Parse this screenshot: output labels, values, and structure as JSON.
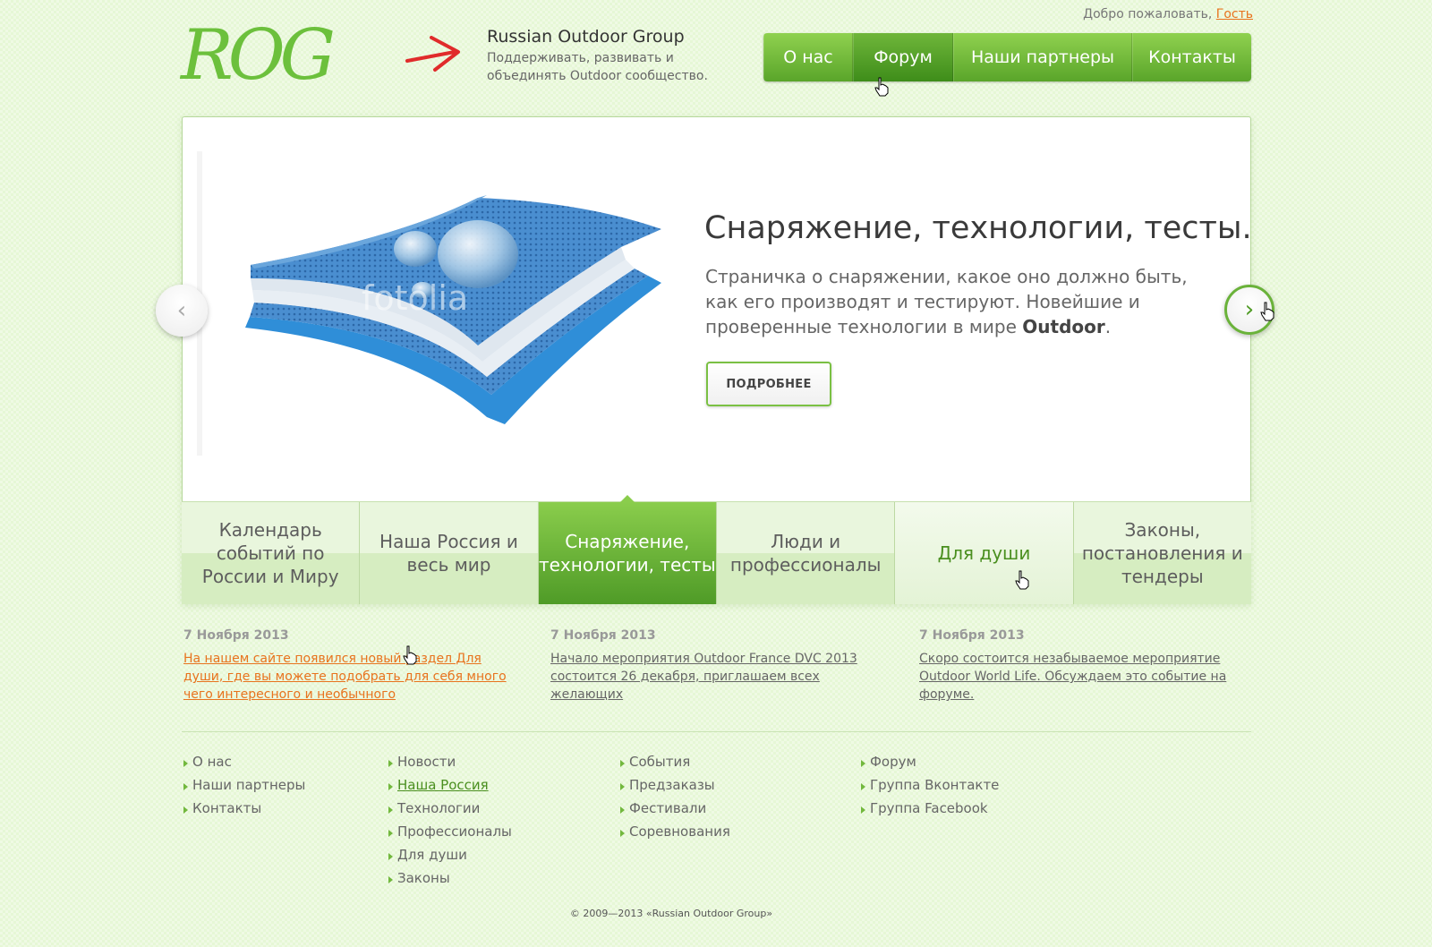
{
  "header": {
    "welcome_text": "Добро пожаловать,",
    "welcome_user": "Гость",
    "brand_title": "Russian Outdoor Group",
    "brand_tagline": "Поддерживать, развивать и объединять Outdoor сообщество.",
    "logo_text": "ROG"
  },
  "nav": {
    "items": [
      {
        "label": "О нас"
      },
      {
        "label": "Форум"
      },
      {
        "label": "Наши партнеры"
      },
      {
        "label": "Контакты"
      }
    ],
    "active": "Форум"
  },
  "slider": {
    "title": "Снаряжение, технологии, тесты.",
    "text": "Страничка о снаряжении, какое оно должно быть, как его производят и тестируют. Новейшие и проверенные технологии в мире",
    "text_bold": "Outdoor",
    "text_end": ".",
    "button_label": "ПОДРОБНЕЕ",
    "prev_icon": "chevron-left-icon",
    "next_icon": "chevron-right-icon",
    "watermark": "fotolia"
  },
  "tabs": [
    {
      "label": "Календарь событий по России и Миру"
    },
    {
      "label": "Наша Россия и весь мир"
    },
    {
      "label": "Снаряжение, технологии, тесты"
    },
    {
      "label": "Люди и профессионалы"
    },
    {
      "label": "Для души"
    },
    {
      "label": "Законы, постановления и тендеры"
    }
  ],
  "news": [
    {
      "date": "7 Ноября 2013",
      "text": "На нашем сайте появился новый раздел Для души, где вы можете подобрать для себя много чего интересного и необычного"
    },
    {
      "date": "7 Ноября 2013",
      "text": "Начало мероприятия Outdoor France DVC 2013 состоится 26 декабря, приглашаем всех желающих"
    },
    {
      "date": "7 Ноября 2013",
      "text": "Скоро состоится незабываемое мероприятие Outdoor World Life. Обсуждаем это событие на форуме."
    }
  ],
  "footer": {
    "col1": [
      "О нас",
      "Наши партнеры",
      "Контакты"
    ],
    "col2": [
      "Новости",
      "Наша Россия",
      "Технологии",
      "Профессионалы",
      "Для души",
      "Законы"
    ],
    "col3": [
      "События",
      "Предзаказы",
      "Фестивали",
      "Соревнования"
    ],
    "col4": [
      "Форум",
      "Группа Вконтакте",
      "Группа Facebook"
    ],
    "copyright": "© 2009—2013 «Russian Outdoor Group»"
  },
  "colors": {
    "accent": "#6ab23a",
    "link_orange": "#e8731e",
    "background": "#e6f7d6"
  }
}
